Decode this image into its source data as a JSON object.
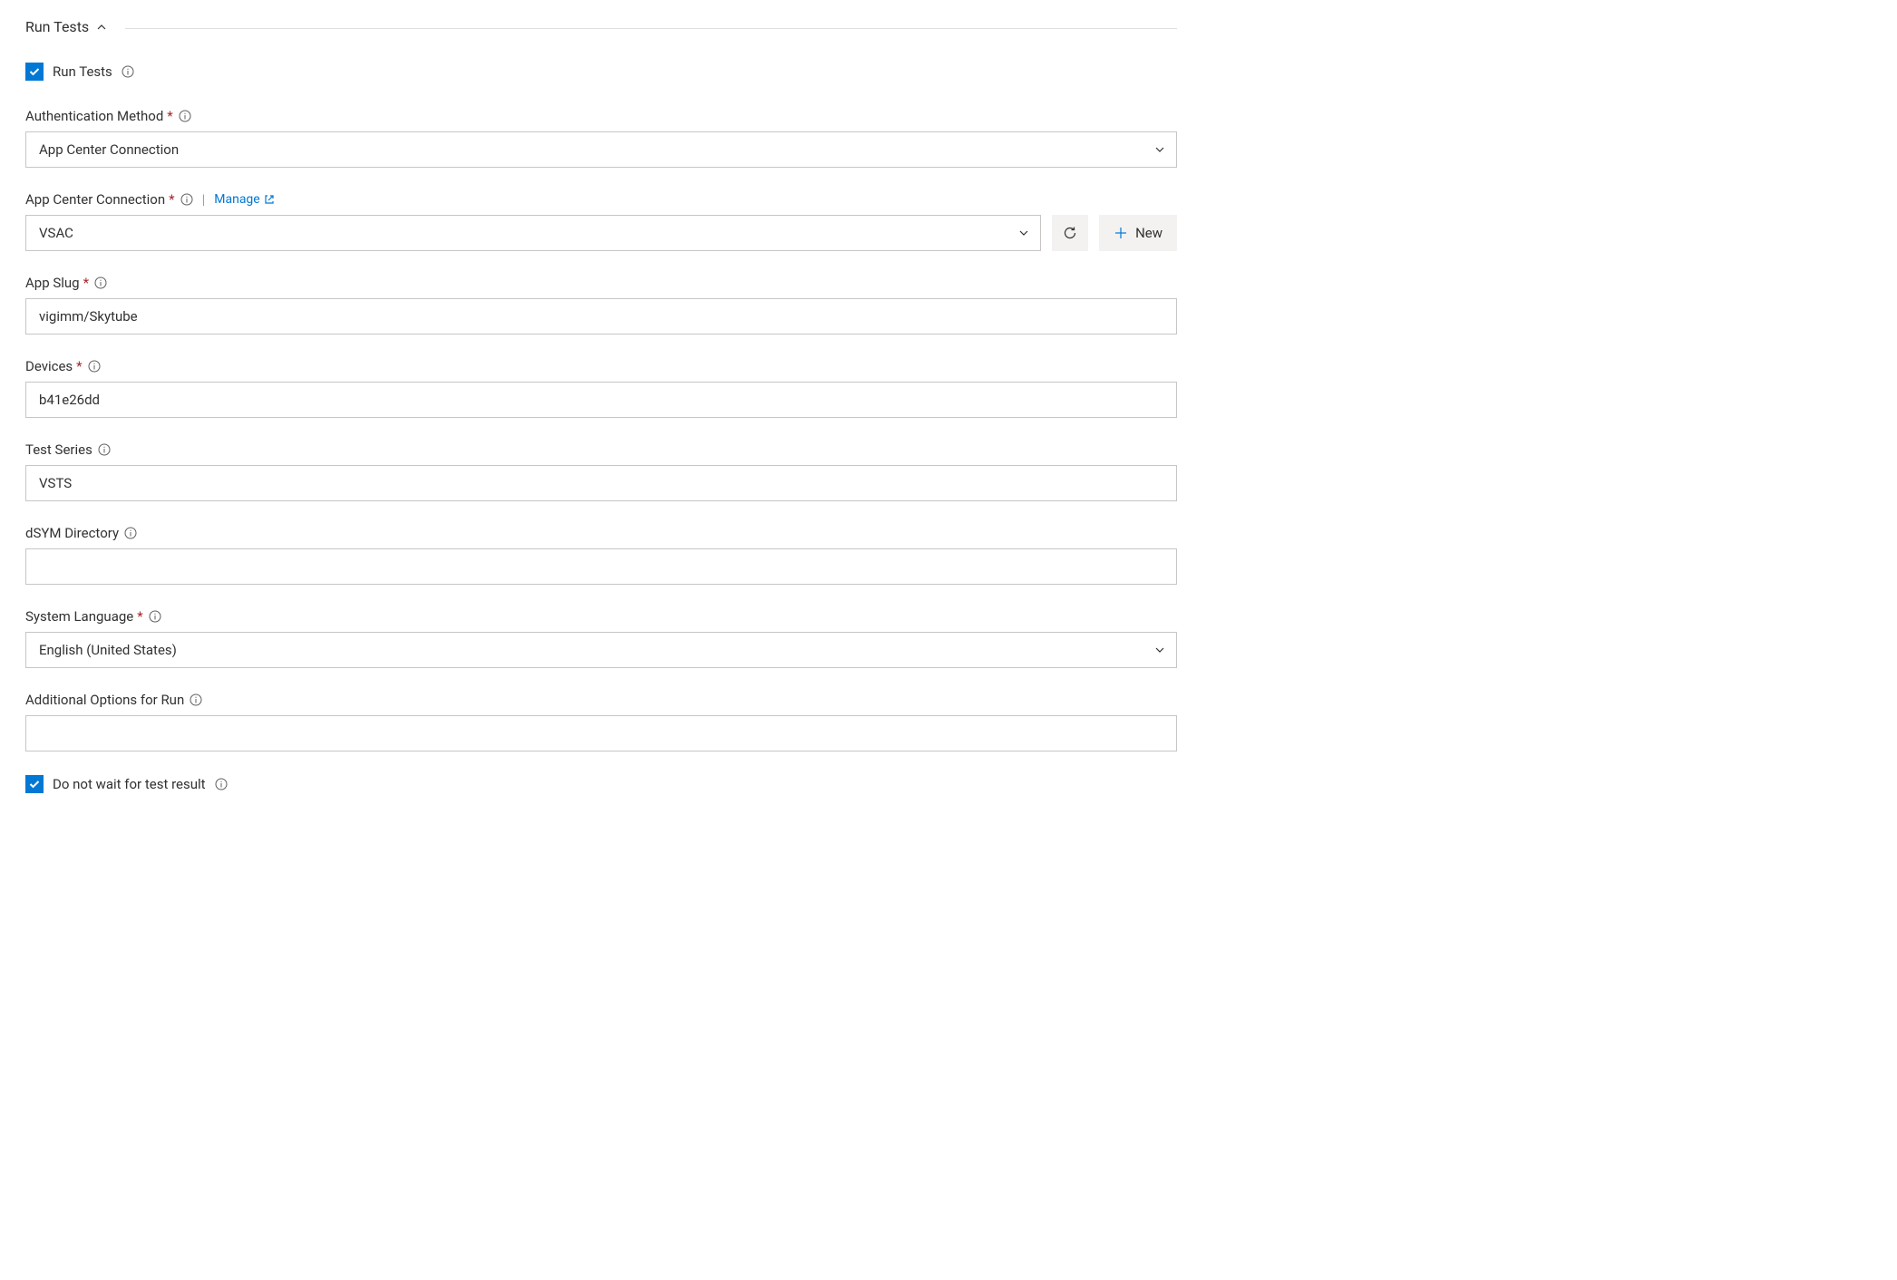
{
  "section": {
    "title": "Run Tests"
  },
  "runTests": {
    "label": "Run Tests",
    "checked": true
  },
  "authMethod": {
    "label": "Authentication Method",
    "required": true,
    "value": "App Center Connection"
  },
  "appCenterConnection": {
    "label": "App Center Connection",
    "required": true,
    "manageLink": "Manage",
    "value": "VSAC",
    "newButton": "New"
  },
  "appSlug": {
    "label": "App Slug",
    "required": true,
    "value": "vigimm/Skytube"
  },
  "devices": {
    "label": "Devices",
    "required": true,
    "value": "b41e26dd"
  },
  "testSeries": {
    "label": "Test Series",
    "required": false,
    "value": "VSTS"
  },
  "dsymDirectory": {
    "label": "dSYM Directory",
    "required": false,
    "value": ""
  },
  "systemLanguage": {
    "label": "System Language",
    "required": true,
    "value": "English (United States)"
  },
  "additionalOptions": {
    "label": "Additional Options for Run",
    "required": false,
    "value": ""
  },
  "doNotWait": {
    "label": "Do not wait for test result",
    "checked": true
  }
}
